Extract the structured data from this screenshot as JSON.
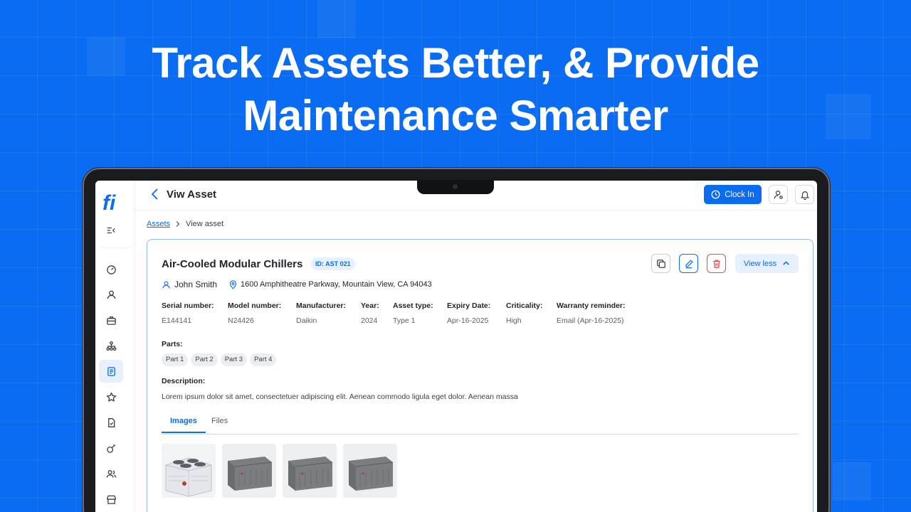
{
  "headline": {
    "line1": "Track Assets Better, & Provide",
    "line2": "Maintenance Smarter"
  },
  "app": {
    "logo_text": "fi",
    "topbar": {
      "title": "Viw Asset",
      "clock_in_label": "Clock In"
    },
    "breadcrumb": {
      "link": "Assets",
      "current": "View asset"
    },
    "sidebar": {
      "items": [
        {
          "icon": "dashboard-icon"
        },
        {
          "icon": "user-icon"
        },
        {
          "icon": "briefcase-icon"
        },
        {
          "icon": "hierarchy-icon"
        },
        {
          "icon": "asset-document-icon",
          "active": true
        },
        {
          "icon": "star-icon"
        },
        {
          "icon": "checklist-icon"
        },
        {
          "icon": "maintenance-icon"
        },
        {
          "icon": "team-icon"
        },
        {
          "icon": "store-icon"
        }
      ]
    },
    "asset": {
      "name": "Air-Cooled Modular Chillers",
      "id_badge": "ID: AST 021",
      "owner": "John Smith",
      "address": "1600 Amphitheatre Parkway, Mountain View, CA 94043",
      "view_less_label": "View less",
      "fields": [
        {
          "label": "Serial number:",
          "value": "E144141"
        },
        {
          "label": "Model number:",
          "value": "N24426"
        },
        {
          "label": "Manufacturer:",
          "value": "Daikin"
        },
        {
          "label": "Year:",
          "value": "2024"
        },
        {
          "label": "Asset type:",
          "value": "Type 1"
        },
        {
          "label": "Expiry Date:",
          "value": "Apr-16-2025"
        },
        {
          "label": "Criticality:",
          "value": "High"
        },
        {
          "label": "Warranty reminder:",
          "value": "Email (Apr-16-2025)"
        }
      ],
      "parts_label": "Parts:",
      "parts": [
        "Part 1",
        "Part 2",
        "Part 3",
        "Part 4"
      ],
      "description_label": "Description:",
      "description": "Lorem ipsum dolor sit amet, consectetuer adipiscing elit. Aenean commodo ligula eget dolor. Aenean massa",
      "tabs": [
        "Images",
        "Files"
      ],
      "active_tab": "Images"
    }
  },
  "colors": {
    "background": "#0a6cf2",
    "accent": "#0a6cf2",
    "danger": "#e5484d"
  }
}
